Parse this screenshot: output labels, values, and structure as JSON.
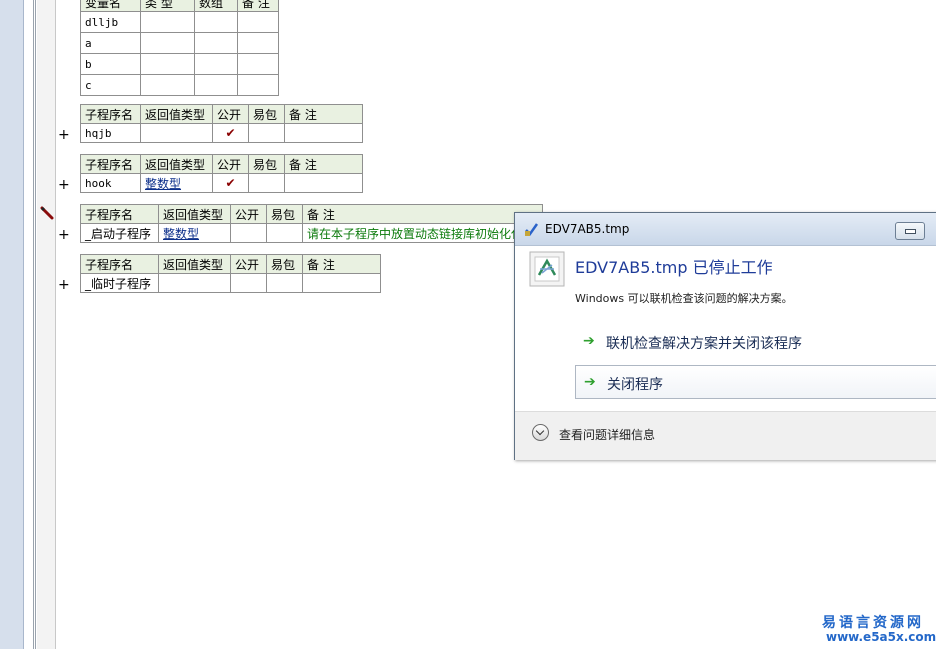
{
  "var_table": {
    "headers": [
      "变量名",
      "类 型",
      "数组",
      "备 注"
    ],
    "rows": [
      "dlljb",
      "a",
      "b",
      "c"
    ]
  },
  "subs": [
    {
      "headers": [
        "子程序名",
        "返回值类型",
        "公开",
        "易包",
        "备 注"
      ],
      "name": "hqjb",
      "ret": "",
      "public": "✔",
      "remark": ""
    },
    {
      "headers": [
        "子程序名",
        "返回值类型",
        "公开",
        "易包",
        "备 注"
      ],
      "name": "hook",
      "ret": "整数型",
      "public": "✔",
      "remark": ""
    },
    {
      "headers": [
        "子程序名",
        "返回值类型",
        "公开",
        "易包",
        "备 注"
      ],
      "name": "_启动子程序",
      "ret": "整数型",
      "public": "",
      "remark": "请在本子程序中放置动态链接库初始化代码"
    },
    {
      "headers": [
        "子程序名",
        "返回值类型",
        "公开",
        "易包",
        "备 注"
      ],
      "name": "_临时子程序",
      "ret": "",
      "public": "",
      "remark": ""
    }
  ],
  "expand_symbol": "+",
  "dialog": {
    "title": "EDV7AB5.tmp",
    "heading": "EDV7AB5.tmp 已停止工作",
    "subtext": "Windows 可以联机检查该问题的解决方案。",
    "option1": "联机检查解决方案并关闭该程序",
    "option2": "关闭程序",
    "arrow": "➔",
    "details": "查看问题详细信息"
  },
  "watermark": {
    "line1": "易语言资源网",
    "line2": "www.e5a5x.com"
  },
  "colors": {
    "header_bg": "#e9f1e1",
    "link_blue": "#0b2e8a",
    "remark_green": "#0b7a0b",
    "dialog_heading": "#1f3c99",
    "watermark": "#2468c9"
  }
}
